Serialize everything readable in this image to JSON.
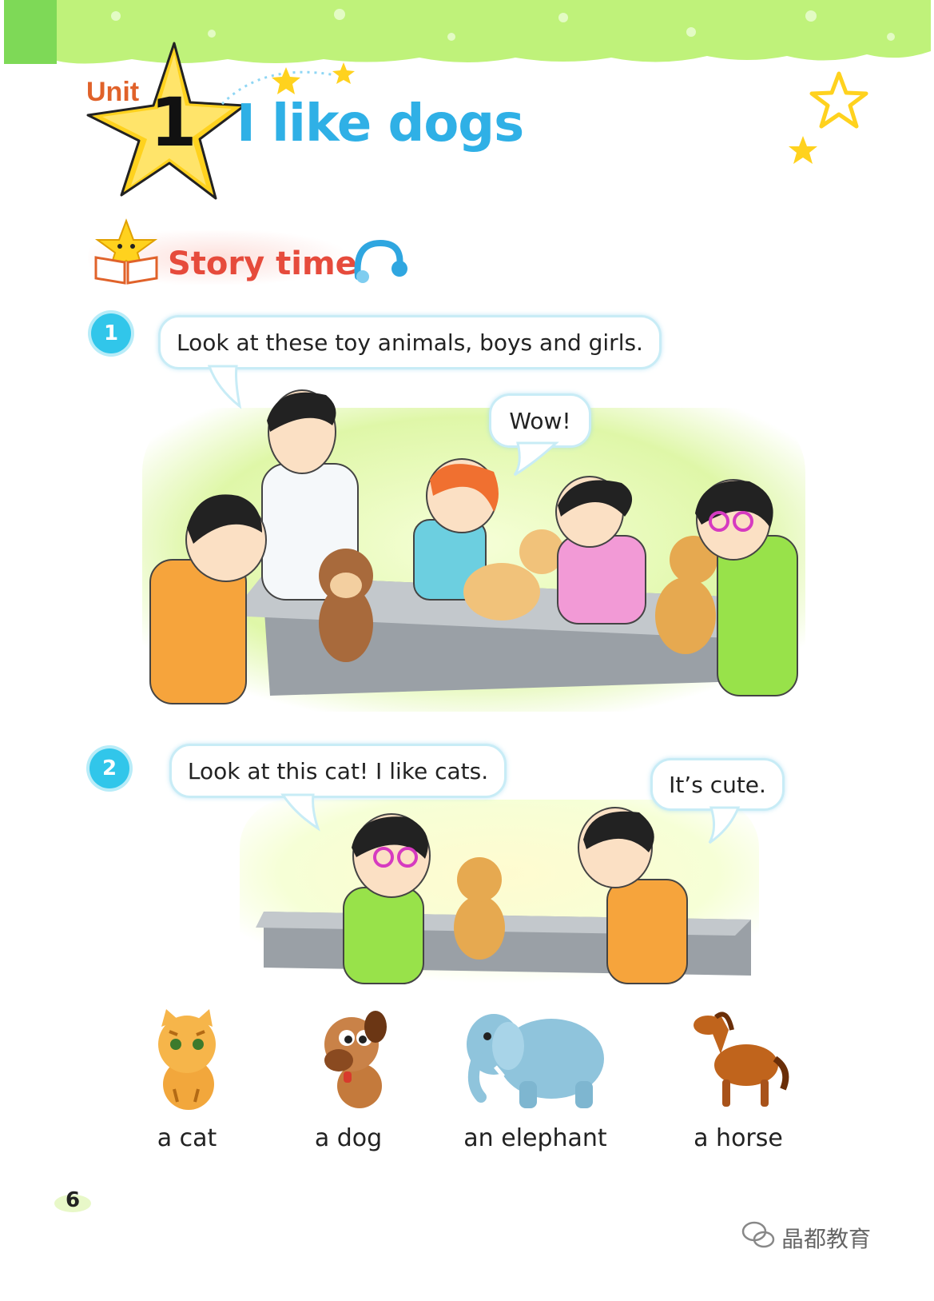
{
  "header": {
    "unit_label": "Unit",
    "unit_number": "1",
    "unit_title": "I like dogs"
  },
  "section": {
    "title": "Story time",
    "audio_icon": "headphones-icon"
  },
  "scenes": [
    {
      "number": "1",
      "bubbles": [
        "Look at these toy animals, boys and girls.",
        "Wow!"
      ]
    },
    {
      "number": "2",
      "bubbles": [
        "Look at this cat! I like cats.",
        "It’s cute."
      ]
    }
  ],
  "vocabulary": [
    {
      "label": "a cat",
      "icon": "cat-icon"
    },
    {
      "label": "a dog",
      "icon": "dog-icon"
    },
    {
      "label": "an elephant",
      "icon": "elephant-icon"
    },
    {
      "label": "a horse",
      "icon": "horse-icon"
    }
  ],
  "footer": {
    "page_number": "6",
    "watermark": "晶都教育"
  },
  "colors": {
    "banner_green": "#bff27a",
    "title_blue": "#2fb0e6",
    "unit_orange": "#e0622a",
    "story_red": "#e64b3c",
    "badge_cyan": "#31c6ea",
    "star_yellow": "#ffd21e"
  }
}
